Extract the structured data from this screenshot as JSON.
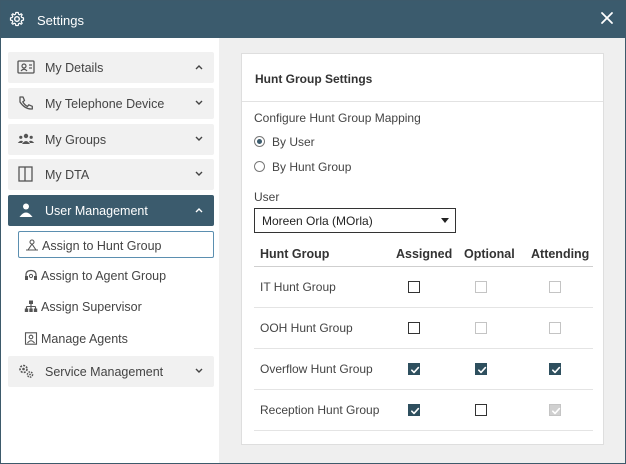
{
  "window": {
    "title": "Settings",
    "icons": {
      "title": "gear-icon",
      "close": "close-icon"
    },
    "colors": {
      "accent": "#3b5b6d",
      "checked": "#2e4f5e",
      "panel": "#efefef"
    }
  },
  "sidebar": {
    "items": [
      {
        "label": "My Details",
        "icon": "id-card-icon",
        "chevron": "up"
      },
      {
        "label": "My Telephone Device",
        "icon": "phone-icon",
        "chevron": "down"
      },
      {
        "label": "My Groups",
        "icon": "group-icon",
        "chevron": "down"
      },
      {
        "label": "My DTA",
        "icon": "panel-icon",
        "chevron": "down"
      },
      {
        "label": "User Management",
        "icon": "user-icon",
        "chevron": "up",
        "active": true
      },
      {
        "label": "Service Management",
        "icon": "gears-icon",
        "chevron": "down"
      }
    ],
    "subitems": [
      {
        "label": "Assign to Hunt Group",
        "icon": "hunt-group-icon",
        "selected": true
      },
      {
        "label": "Assign to Agent Group",
        "icon": "headset-icon"
      },
      {
        "label": "Assign Supervisor",
        "icon": "hierarchy-icon"
      },
      {
        "label": "Manage Agents",
        "icon": "agent-card-icon"
      }
    ]
  },
  "panel": {
    "title": "Hunt Group Settings",
    "config_label": "Configure Hunt Group Mapping",
    "radios": [
      {
        "label": "By User",
        "selected": true
      },
      {
        "label": "By Hunt Group",
        "selected": false
      }
    ],
    "user_label": "User",
    "user_value": "Moreen Orla (MOrla)",
    "table": {
      "headers": [
        "Hunt Group",
        "Assigned",
        "Optional",
        "Attending"
      ],
      "rows": [
        {
          "name": "IT Hunt Group",
          "assigned": "unchecked",
          "optional": "disabled",
          "attending": "disabled"
        },
        {
          "name": "OOH Hunt Group",
          "assigned": "unchecked",
          "optional": "disabled",
          "attending": "disabled"
        },
        {
          "name": "Overflow Hunt Group",
          "assigned": "checked",
          "optional": "checked",
          "attending": "checked"
        },
        {
          "name": "Reception Hunt Group",
          "assigned": "checked",
          "optional": "unchecked",
          "attending": "checked-disabled"
        }
      ]
    }
  }
}
